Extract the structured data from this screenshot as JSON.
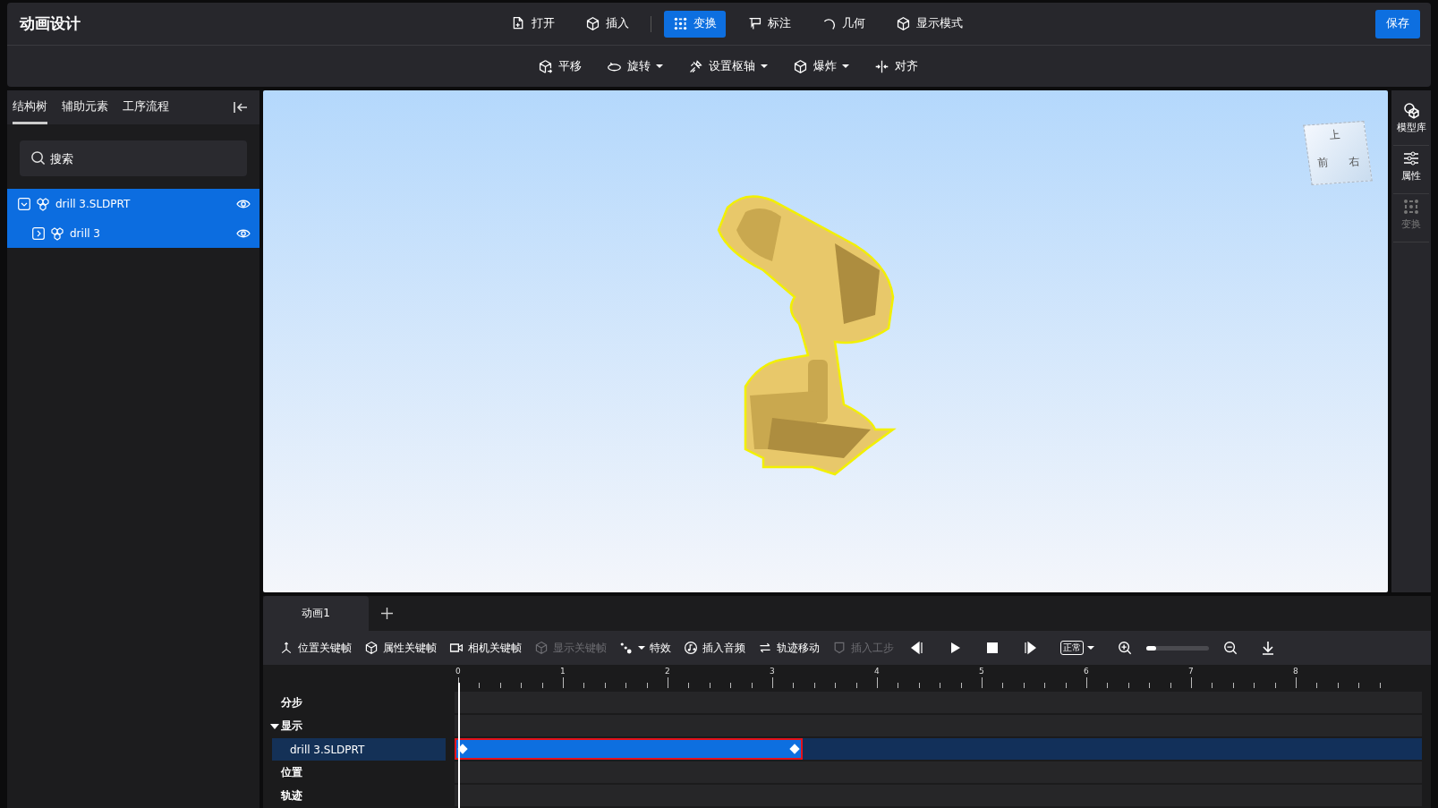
{
  "app_title": "动画设计",
  "main_tools": [
    {
      "label": "打开",
      "selected": false
    },
    {
      "label": "插入",
      "selected": false
    },
    {
      "label": "变换",
      "selected": true
    },
    {
      "label": "标注",
      "selected": false
    },
    {
      "label": "几何",
      "selected": false
    },
    {
      "label": "显示模式",
      "selected": false
    }
  ],
  "save_button": "保存",
  "sub_tools": [
    {
      "label": "平移",
      "dropdown": false
    },
    {
      "label": "旋转",
      "dropdown": true
    },
    {
      "label": "设置枢轴",
      "dropdown": true
    },
    {
      "label": "爆炸",
      "dropdown": true
    },
    {
      "label": "对齐",
      "dropdown": false
    }
  ],
  "left_tabs": [
    {
      "label": "结构树",
      "selected": true
    },
    {
      "label": "辅助元素",
      "selected": false
    },
    {
      "label": "工序流程",
      "selected": false
    }
  ],
  "search": {
    "placeholder": "搜索"
  },
  "tree": [
    {
      "label": "drill 3.SLDPRT",
      "expanded": true,
      "visible": true,
      "selected": true,
      "children": [
        {
          "label": "drill 3",
          "expanded": false,
          "visible": true,
          "selected": true
        }
      ]
    }
  ],
  "view_cube": {
    "top": "上",
    "front": "前",
    "right": "右"
  },
  "right_bar": [
    {
      "label": "模型库",
      "disabled": false
    },
    {
      "label": "属性",
      "disabled": false
    },
    {
      "label": "变换",
      "disabled": true
    }
  ],
  "animation_tabs": [
    {
      "label": "动画1",
      "selected": true
    }
  ],
  "timeline_tools": [
    {
      "label": "位置关键帧",
      "disabled": false,
      "dropdown": false
    },
    {
      "label": "属性关键帧",
      "disabled": false,
      "dropdown": false
    },
    {
      "label": "相机关键帧",
      "disabled": false,
      "dropdown": false
    },
    {
      "label": "显示关键帧",
      "disabled": true,
      "dropdown": false
    },
    {
      "label": "特效",
      "disabled": false,
      "dropdown": true
    },
    {
      "label": "插入音频",
      "disabled": false,
      "dropdown": false
    },
    {
      "label": "轨迹移动",
      "disabled": false,
      "dropdown": false
    },
    {
      "label": "插入工步",
      "disabled": true,
      "dropdown": false
    }
  ],
  "playback": {
    "speed_label": "正常",
    "zoom": {
      "level": 0.15
    }
  },
  "ruler": [
    "0",
    "1",
    "2",
    "3",
    "4",
    "5",
    "6",
    "7",
    "8"
  ],
  "tracks": [
    {
      "label": "分步",
      "kind": "group",
      "selected": false
    },
    {
      "label": "显示",
      "kind": "expandable",
      "expanded": true,
      "selected": false
    },
    {
      "label": "drill 3.SLDPRT",
      "kind": "item",
      "selected": true,
      "has_clip": true
    },
    {
      "label": "位置",
      "kind": "group",
      "selected": false
    },
    {
      "label": "轨迹",
      "kind": "group",
      "selected": false
    }
  ]
}
